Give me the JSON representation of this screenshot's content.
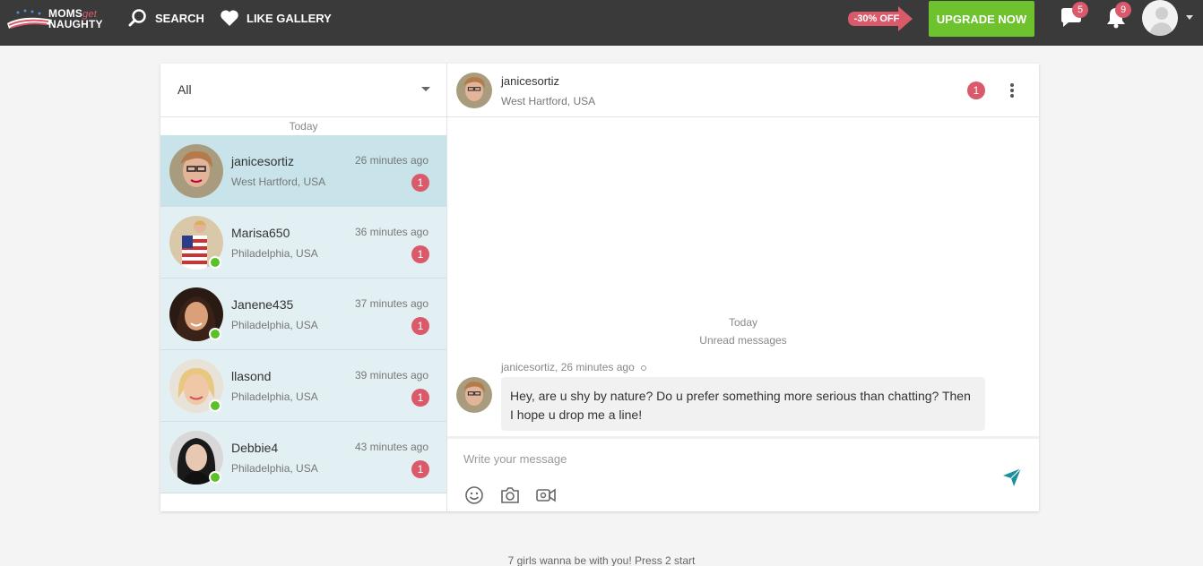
{
  "header": {
    "logo": {
      "line1": "MOMS",
      "get": "get",
      "line2": "NAUGHTY"
    },
    "nav": {
      "search_label": "SEARCH",
      "gallery_label": "LIKE GALLERY"
    },
    "promo_label": "-30% OFF",
    "upgrade_label": "UPGRADE NOW",
    "messages_count": "5",
    "notifications_count": "9"
  },
  "sidebar": {
    "filter_value": "All",
    "day_label": "Today",
    "conversations": [
      {
        "name": "janicesortiz",
        "location": "West Hartford, USA",
        "time": "26 minutes ago",
        "unread": "1",
        "active": true,
        "online": false
      },
      {
        "name": "Marisa650",
        "location": "Philadelphia, USA",
        "time": "36 minutes ago",
        "unread": "1",
        "active": false,
        "online": true
      },
      {
        "name": "Janene435",
        "location": "Philadelphia, USA",
        "time": "37 minutes ago",
        "unread": "1",
        "active": false,
        "online": true
      },
      {
        "name": "llasond",
        "location": "Philadelphia, USA",
        "time": "39 minutes ago",
        "unread": "1",
        "active": false,
        "online": true
      },
      {
        "name": "Debbie4",
        "location": "Philadelphia, USA",
        "time": "43 minutes ago",
        "unread": "1",
        "active": false,
        "online": true
      }
    ]
  },
  "chat": {
    "name": "janicesortiz",
    "location": "West Hartford, USA",
    "unread": "1",
    "day_label": "Today",
    "unread_label": "Unread messages",
    "message": {
      "meta": "janicesortiz, 26 minutes ago",
      "text": "Hey, are u shy by nature? Do u prefer something more serious than chatting? Then I hope u drop me a line!"
    },
    "composer_placeholder": "Write your message"
  },
  "footer_text": "7 girls wanna be with you! Press 2 start",
  "colors": {
    "topbar": "#3a3a3a",
    "upgrade": "#6ec22d",
    "badge": "#d95a6a",
    "online": "#5bc02a",
    "send": "#1a8fa0"
  }
}
